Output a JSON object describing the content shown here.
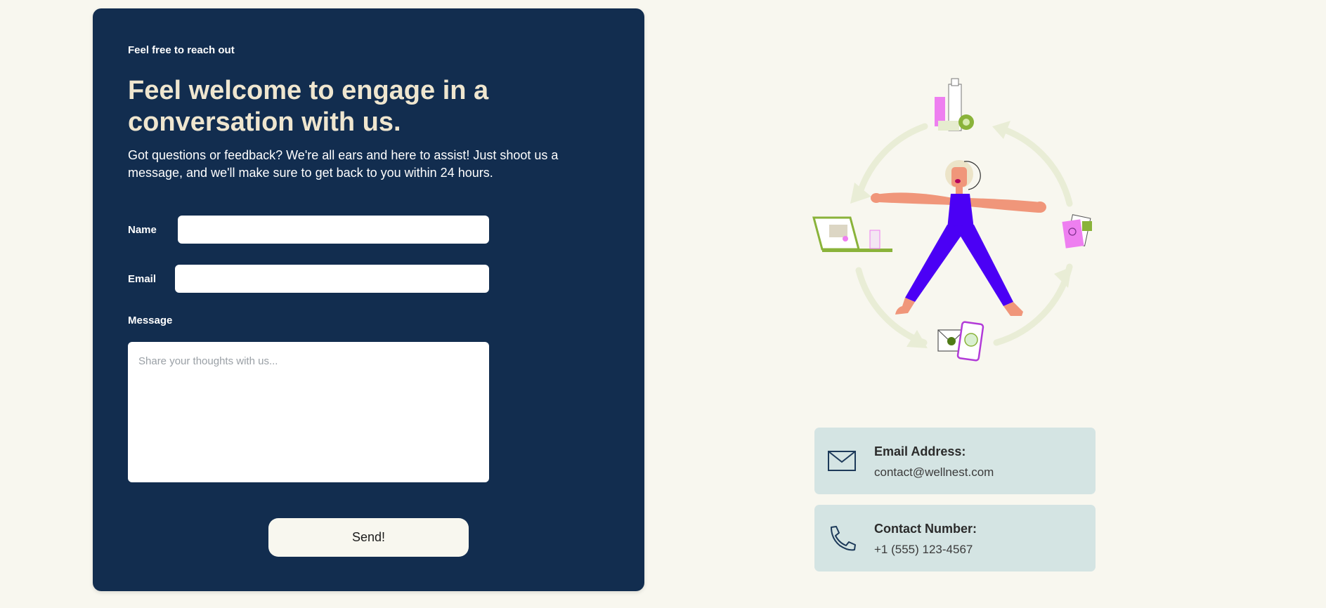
{
  "form": {
    "eyebrow": "Feel free to reach out",
    "headline": "Feel welcome to engage in a conversation with us.",
    "intro": "Got questions or feedback? We're all ears and here to assist! Just shoot us a message, and we'll make sure to get back to you within 24 hours.",
    "name_label": "Name",
    "name_value": "",
    "email_label": "Email",
    "email_value": "",
    "message_label": "Message",
    "message_placeholder": "Share your thoughts with us...",
    "message_value": "",
    "send_label": "Send!"
  },
  "contact": {
    "email_title": "Email Address:",
    "email_value": "contact@wellnest.com",
    "email_icon": "envelope-icon",
    "phone_title": "Contact Number:",
    "phone_value": "+1 (555) 123-4567",
    "phone_icon": "phone-icon"
  },
  "colors": {
    "background": "#f8f7ef",
    "card": "#122d4f",
    "headline": "#efe6cf",
    "info_card": "#d4e4e3",
    "figure_body": "#4b00f5",
    "accent_green": "#8ab33a",
    "accent_pink": "#ee7ff0"
  }
}
